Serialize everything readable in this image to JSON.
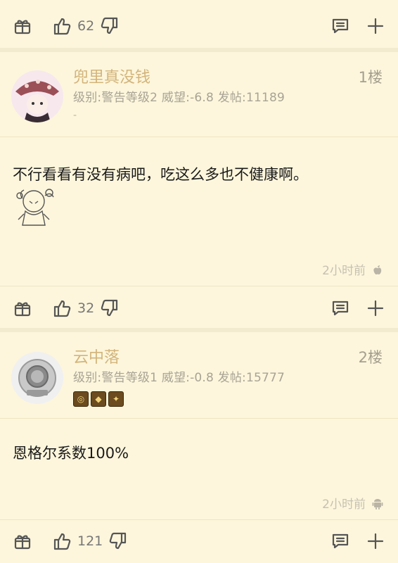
{
  "top_bar": {
    "like_count": "62"
  },
  "posts": [
    {
      "username": "兜里真没钱",
      "floor": "1楼",
      "meta": "级别:警告等级2 威望:-6.8 发帖:11189",
      "dash": "-",
      "content": "不行看看有没有病吧，吃这么多也不健康啊。",
      "time": "2小时前",
      "os_icon": "apple-icon",
      "like_count": "32"
    },
    {
      "username": "云中落",
      "floor": "2楼",
      "meta": "级别:警告等级1 威望:-0.8 发帖:15777",
      "content": "恩格尔系数100%",
      "time": "2小时前",
      "os_icon": "android-icon",
      "like_count": "121"
    }
  ],
  "colors": {
    "background": "#fdf6dc",
    "username": "#d3b47b",
    "meta": "#a8a395"
  }
}
